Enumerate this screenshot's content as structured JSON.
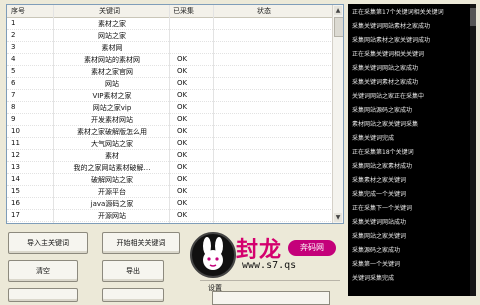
{
  "grid": {
    "columns": [
      "序号",
      "关键词",
      "已采集",
      "状态"
    ],
    "rows": [
      {
        "id": "1",
        "kw": "素材之家",
        "done": ""
      },
      {
        "id": "2",
        "kw": "网站之家",
        "done": ""
      },
      {
        "id": "3",
        "kw": "素材网",
        "done": ""
      },
      {
        "id": "4",
        "kw": "素材网站的素材网",
        "done": "OK"
      },
      {
        "id": "5",
        "kw": "素材之家官网",
        "done": "OK"
      },
      {
        "id": "6",
        "kw": "网站",
        "done": "OK"
      },
      {
        "id": "7",
        "kw": "VIP素材之家",
        "done": "OK"
      },
      {
        "id": "8",
        "kw": "网站之家vip",
        "done": "OK"
      },
      {
        "id": "9",
        "kw": "开发素材网站",
        "done": "OK"
      },
      {
        "id": "10",
        "kw": "素材之家破解版怎么用",
        "done": "OK"
      },
      {
        "id": "11",
        "kw": "大气网站之家",
        "done": "OK"
      },
      {
        "id": "12",
        "kw": "素材",
        "done": "OK"
      },
      {
        "id": "13",
        "kw": "我的之家网站素材破解…",
        "done": "OK"
      },
      {
        "id": "14",
        "kw": "破解网站之家",
        "done": "OK"
      },
      {
        "id": "15",
        "kw": "开源平台",
        "done": "OK"
      },
      {
        "id": "16",
        "kw": "java源码之家",
        "done": "OK"
      },
      {
        "id": "17",
        "kw": "开源网站",
        "done": "OK"
      }
    ]
  },
  "buttons": {
    "import_keywords": "导入主关键词",
    "start_collect": "开始相关关键词",
    "clear": "清空",
    "export": "导出"
  },
  "group": {
    "label": "设置"
  },
  "logo": {
    "tag": "奔码网",
    "url": "www.s7.qs"
  },
  "log_lines": [
    "正在采集第17个关键词相关关键词",
    "采集关键词网站素材之家成功",
    "采集网站素材之家关键词成功",
    "正在采集关键词相关关键词",
    "采集关键词网站之家成功",
    "采集关键词素材之家成功",
    "关键词网站之家正在采集中",
    "采集网站源码之家成功",
    "素材网站之家关键词采集",
    "采集关键词完成",
    "正在采集第18个关键词",
    "采集网站之家素材成功",
    "采集素材之家关键词",
    "采集完成一个关键词",
    "正在采集下一个关键词",
    "采集关键词网站成功",
    "采集网站之家关键词",
    "采集源码之家成功",
    "采集第一个关键词",
    "关键词采集完成"
  ]
}
